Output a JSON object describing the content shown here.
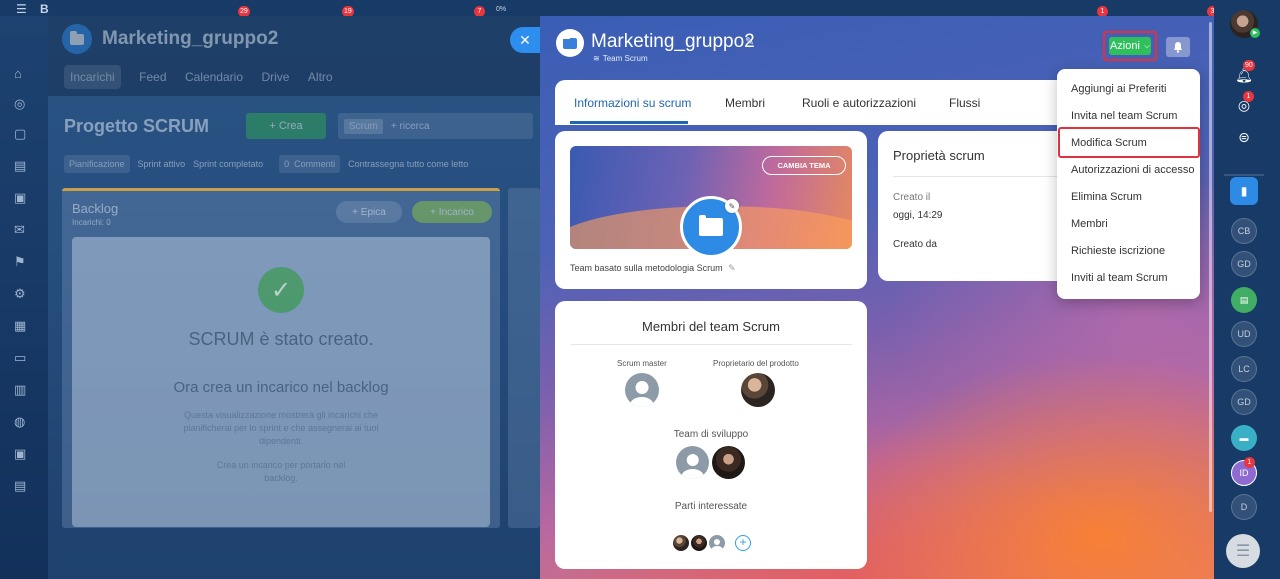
{
  "background_app": {
    "group_title": "Marketing_gruppo2",
    "tabs": [
      "Incarichi",
      "Feed",
      "Calendario",
      "Drive",
      "Altro"
    ],
    "project_title": "Progetto SCRUM",
    "create_label": "Crea",
    "filter_chip": "Scrum",
    "search_placeholder": "+ ricerca",
    "subtabs": [
      "Pianificazione",
      "Sprint attivo",
      "Sprint completato"
    ],
    "comments_count": "0",
    "comments_label": "Commenti",
    "mark_all_read": "Contrassegna tutto come letto",
    "backlog_title": "Backlog",
    "backlog_subtitle": "Incarichi: 0",
    "epic_button": "Epica",
    "task_button": "Incarico",
    "empty_title": "SCRUM è stato creato.",
    "empty_subtitle": "Ora crea un incarico nel backlog",
    "empty_desc": "Questa visualizzazione mostrerà gli incarichi che pianificherai per lo sprint e che assegnerai ai tuoi dipendenti.",
    "empty_hint": "Crea un incarico per portarlo nel backlog.",
    "top_counters": [
      "29",
      "19",
      "7",
      "0%"
    ]
  },
  "header": {
    "title": "Marketing_gruppo2",
    "subtitle": "Team Scrum",
    "actions_label": "Azioni"
  },
  "tabs": {
    "info": "Informazioni su scrum",
    "members": "Membri",
    "roles": "Ruoli e autorizzazioni",
    "flows": "Flussi"
  },
  "cover": {
    "change_theme": "CAMBIA TEMA",
    "caption": "Team basato sulla metodologia Scrum"
  },
  "properties": {
    "title": "Proprietà scrum",
    "created_label": "Creato il",
    "created_value": "oggi, 14:29",
    "created_by_label": "Creato da"
  },
  "team": {
    "title": "Membri del team Scrum",
    "scrum_master_label": "Scrum master",
    "product_owner_label": "Proprietario del prodotto",
    "dev_team_label": "Team di sviluppo",
    "stakeholders_label": "Parti interessate"
  },
  "actions_menu": {
    "items": [
      "Aggiungi ai Preferiti",
      "Invita nel team Scrum",
      "Modifica Scrum",
      "Autorizzazioni di accesso",
      "Elimina Scrum",
      "Membri",
      "Richieste iscrizione",
      "Inviti al team Scrum"
    ],
    "highlighted": "Modifica Scrum"
  },
  "right_bar": {
    "notifications_badge": "90",
    "activity_badge": "1",
    "avatars": [
      "CB",
      "GD",
      "UD",
      "LC",
      "GD",
      "ID",
      "D"
    ],
    "id_badge": "1",
    "top_badge": "3",
    "left_badge": "1"
  },
  "colors": {
    "accent_blue": "#2067b0",
    "action_green": "#2fc05b",
    "highlight_red": "#e0313f"
  }
}
